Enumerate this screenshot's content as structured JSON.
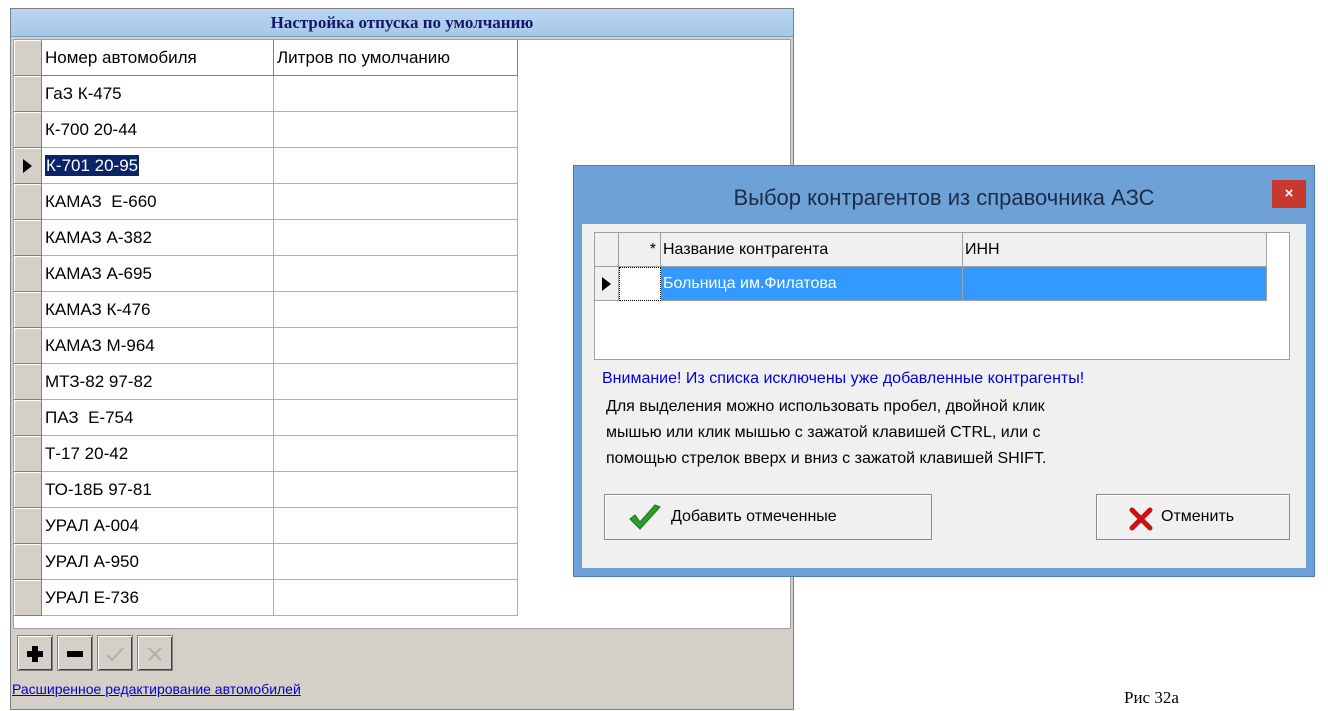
{
  "left_window": {
    "title": "Настройка отпуска по умолчанию",
    "columns": [
      "Номер автомобиля",
      "Литров по умолчанию"
    ],
    "rows": [
      {
        "vehicle": "ГаЗ К-475",
        "liters": ""
      },
      {
        "vehicle": "К-700 20-44",
        "liters": ""
      },
      {
        "vehicle": "К-701 20-95",
        "liters": ""
      },
      {
        "vehicle": "КАМАЗ  Е-660",
        "liters": ""
      },
      {
        "vehicle": "КАМАЗ А-382",
        "liters": ""
      },
      {
        "vehicle": "КАМАЗ А-695",
        "liters": ""
      },
      {
        "vehicle": "КАМАЗ К-476",
        "liters": ""
      },
      {
        "vehicle": "КАМАЗ М-964",
        "liters": ""
      },
      {
        "vehicle": "МТЗ-82 97-82",
        "liters": ""
      },
      {
        "vehicle": "ПАЗ  Е-754",
        "liters": ""
      },
      {
        "vehicle": "Т-17 20-42",
        "liters": ""
      },
      {
        "vehicle": "ТО-18Б 97-81",
        "liters": ""
      },
      {
        "vehicle": "УРАЛ А-004",
        "liters": ""
      },
      {
        "vehicle": "УРАЛ А-950",
        "liters": ""
      },
      {
        "vehicle": "УРАЛ Е-736",
        "liters": ""
      }
    ],
    "selected_row": 2,
    "toolbar": {
      "add_icon": "plus-icon",
      "remove_icon": "minus-icon",
      "confirm_icon": "check-icon",
      "cancel_icon": "cross-icon"
    },
    "extended_edit_link": "Расширенное редактирование автомобилей"
  },
  "dialog": {
    "title": "Выбор контрагентов из справочника АЗС",
    "close_label": "×",
    "columns": [
      "*",
      "Название контрагента",
      "ИНН"
    ],
    "rows": [
      {
        "name": "Больница им.Филатова",
        "inn": ""
      }
    ],
    "warning": "Внимание! Из списка исключены уже добавленные контрагенты!",
    "hint_lines": [
      "Для выделения можно использовать пробел, двойной клик",
      "мышью или клик мышью с зажатой клавишей CTRL, или с",
      "помощью стрелок вверх и вниз с зажатой клавишей SHIFT."
    ],
    "add_button": "Добавить отмеченные",
    "cancel_button": "Отменить",
    "colors": {
      "titlebar": "#6ea2d6",
      "selection": "#3399ff",
      "warning_text": "#0000dd",
      "close": "#c8382e"
    }
  },
  "caption": "Рис 32а"
}
